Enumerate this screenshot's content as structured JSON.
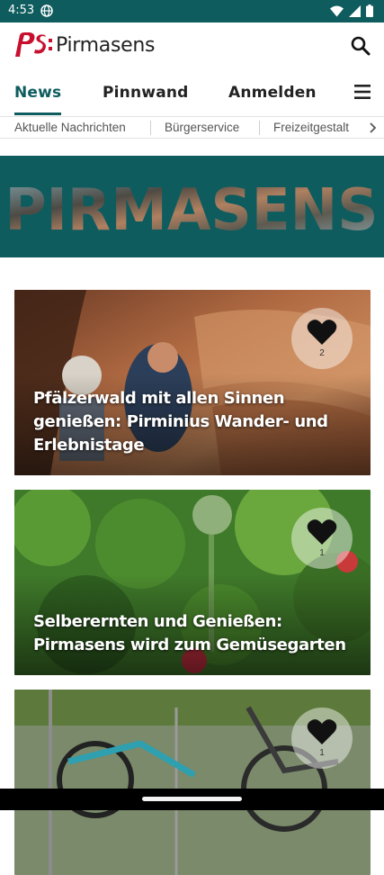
{
  "status": {
    "time": "4:53"
  },
  "app": {
    "name": "Pirmasens",
    "logo_text": "PS:"
  },
  "tabs": [
    {
      "label": "News",
      "active": true
    },
    {
      "label": "Pinnwand",
      "active": false
    },
    {
      "label": "Anmelden",
      "active": false
    }
  ],
  "categories": [
    "Aktuelle Nachrichten",
    "Bürgerservice",
    "Freizeitgestalt"
  ],
  "banner": {
    "text": "PIRMASENS"
  },
  "articles": [
    {
      "title": "Pfälzerwald mit allen Sinnen genießen: Pirminius Wander- und Erlebnistage",
      "likes": "2"
    },
    {
      "title": "Selberernten und Genießen: Pirmasens wird zum Gemüsegarten",
      "likes": "1"
    },
    {
      "title": "",
      "likes": "1"
    }
  ],
  "colors": {
    "primary": "#0e5c5e",
    "logo_red": "#c8102e"
  }
}
